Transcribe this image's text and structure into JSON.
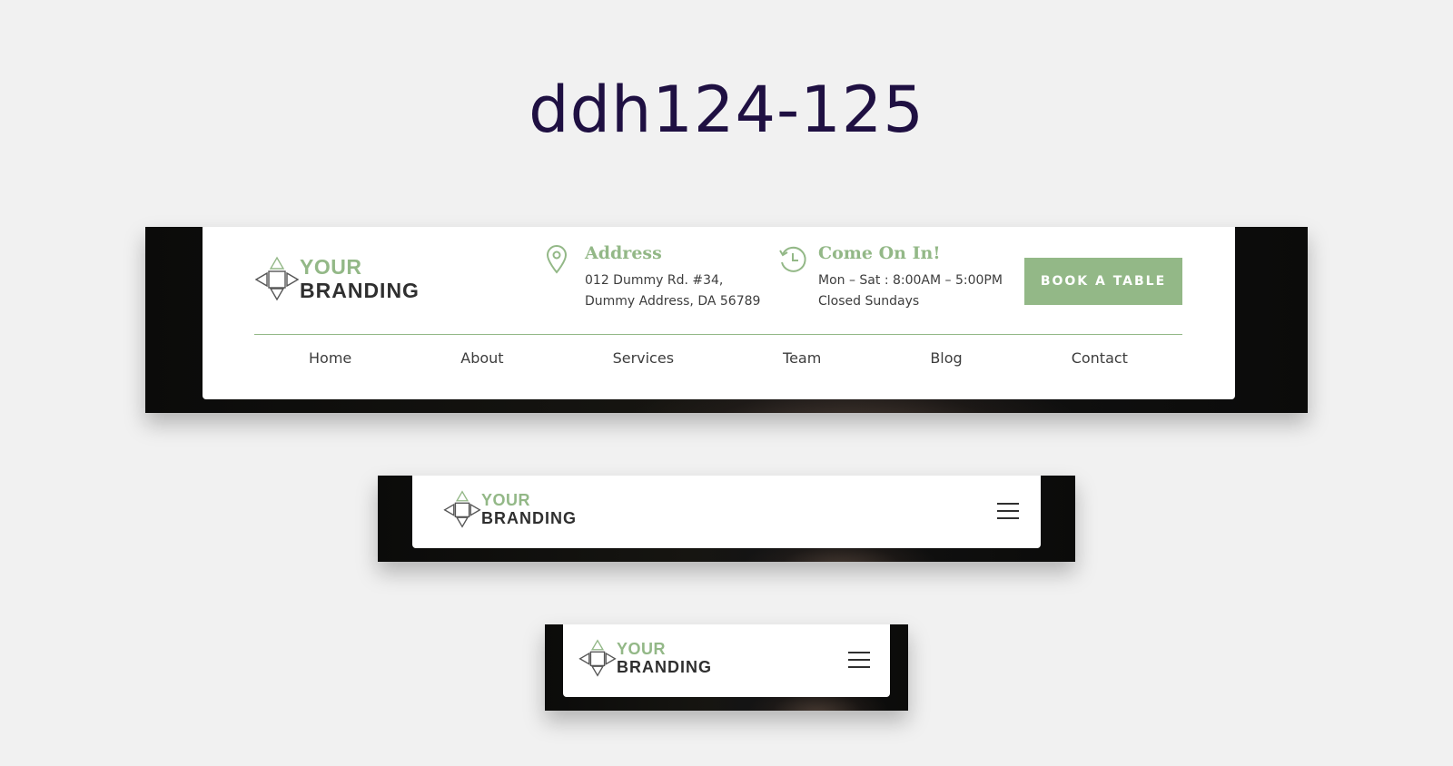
{
  "page": {
    "title": "ddh124-125"
  },
  "brand": {
    "line1": "YOUR",
    "line2": "BRANDING"
  },
  "header": {
    "address": {
      "title": "Address",
      "line1": "012 Dummy Rd. #34,",
      "line2": "Dummy Address, DA 56789",
      "icon": "map-pin-icon"
    },
    "hours": {
      "title": "Come On In!",
      "line1": "Mon – Sat : 8:00AM – 5:00PM",
      "line2": "Closed Sundays",
      "icon": "clock-history-icon"
    },
    "cta_label": "BOOK A TABLE"
  },
  "nav": {
    "items": [
      {
        "label": "Home"
      },
      {
        "label": "About"
      },
      {
        "label": "Services"
      },
      {
        "label": "Team"
      },
      {
        "label": "Blog"
      },
      {
        "label": "Contact"
      }
    ]
  },
  "colors": {
    "accent": "#93b887",
    "title": "#1f1042",
    "page_bg": "#f1f1f1",
    "text": "#3d3d3d"
  },
  "icons": {
    "menu": "hamburger-menu-icon",
    "logo": "logo-diamond-icon"
  }
}
